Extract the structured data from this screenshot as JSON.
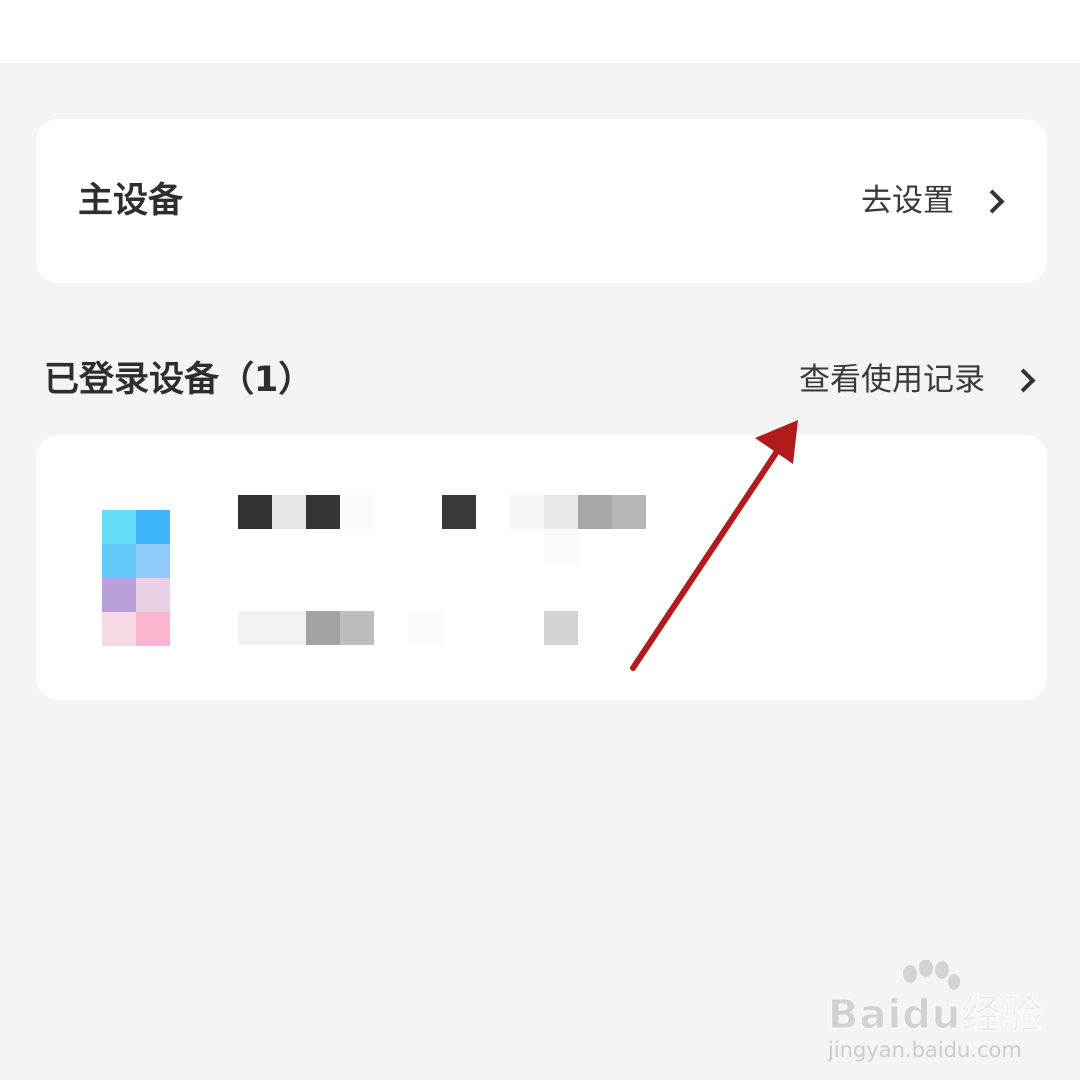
{
  "primary_device": {
    "title": "主设备",
    "action_label": "去设置",
    "chevron_icon": "chevron-right-icon"
  },
  "logged_in_devices": {
    "title": "已登录设备（1）",
    "action_label": "查看使用记录",
    "chevron_icon": "chevron-right-icon"
  },
  "watermark": {
    "brand": "Baidu经验",
    "url": "jingyan.baidu.com"
  },
  "colors": {
    "background": "#f4f4f4",
    "card": "#ffffff",
    "text": "#333333",
    "annotation_arrow": "#b01b1b"
  }
}
